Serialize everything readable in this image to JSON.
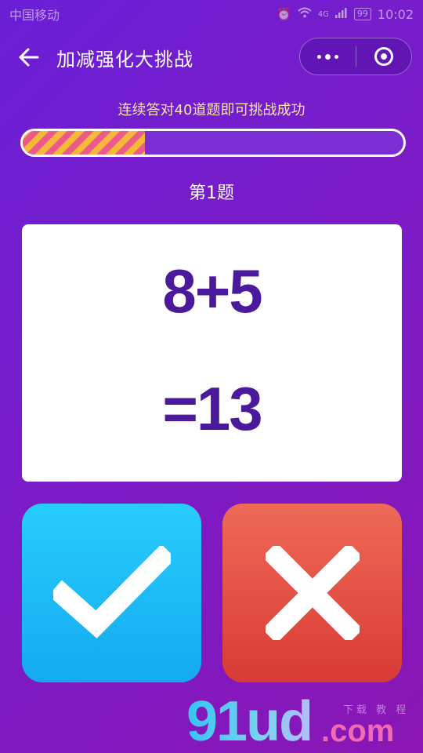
{
  "status_bar": {
    "carrier": "中国移动",
    "network": "4G",
    "battery": "99",
    "time": "10:02"
  },
  "nav": {
    "title": "加减强化大挑战",
    "icons": [
      "back-arrow-icon",
      "more-dots-icon",
      "close-target-icon"
    ]
  },
  "challenge": {
    "instruction": "连续答对40道题即可挑战成功",
    "progress_percent": 32,
    "question_label": "第1题"
  },
  "question": {
    "expression": "8+5",
    "answer": "=13"
  },
  "answers": {
    "correct_icon": "checkmark-icon",
    "wrong_icon": "cross-icon",
    "correct_color": "#1fbdf7",
    "wrong_color": "#e04d42"
  },
  "watermark": {
    "text": "91ud",
    "suffix": ".com",
    "small": "下载 教 程"
  },
  "colors": {
    "background": "#7320cc",
    "equation": "#4b1a9c",
    "instruction": "#f7e6a8"
  }
}
